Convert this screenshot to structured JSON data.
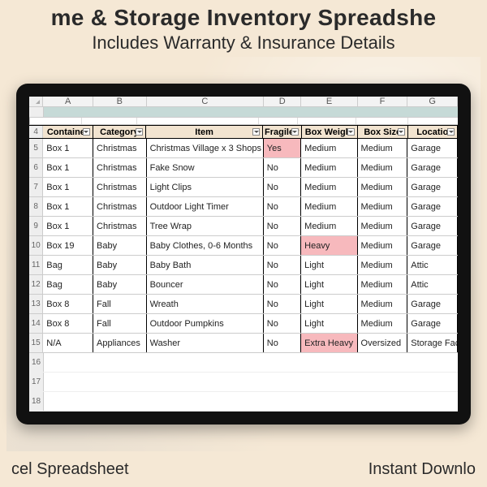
{
  "hero": {
    "title": "me & Storage Inventory Spreadshe",
    "subtitle": "Includes Warranty & Insurance Details"
  },
  "footer": {
    "left": "cel Spreadsheet",
    "right": "Instant Downlo"
  },
  "spreadsheet": {
    "colLetters": [
      "A",
      "B",
      "C",
      "D",
      "E",
      "F",
      "G"
    ],
    "bannerRowNum": "",
    "spacerRowNum": "",
    "headerRowNum": "4",
    "headers": [
      "Container",
      "Category",
      "Item",
      "Fragile?",
      "Box Weight",
      "Box Size",
      "Locatio"
    ],
    "rows": [
      {
        "num": "5",
        "cells": [
          "Box 1",
          "Christmas",
          "Christmas Village x 3 Shops",
          "Yes",
          "Medium",
          "Medium",
          "Garage"
        ],
        "hl": [
          3
        ]
      },
      {
        "num": "6",
        "cells": [
          "Box 1",
          "Christmas",
          "Fake Snow",
          "No",
          "Medium",
          "Medium",
          "Garage"
        ],
        "hl": []
      },
      {
        "num": "7",
        "cells": [
          "Box 1",
          "Christmas",
          "Light Clips",
          "No",
          "Medium",
          "Medium",
          "Garage"
        ],
        "hl": []
      },
      {
        "num": "8",
        "cells": [
          "Box 1",
          "Christmas",
          "Outdoor Light Timer",
          "No",
          "Medium",
          "Medium",
          "Garage"
        ],
        "hl": []
      },
      {
        "num": "9",
        "cells": [
          "Box 1",
          "Christmas",
          "Tree Wrap",
          "No",
          "Medium",
          "Medium",
          "Garage"
        ],
        "hl": []
      },
      {
        "num": "10",
        "cells": [
          "Box 19",
          "Baby",
          "Baby Clothes, 0-6 Months",
          "No",
          "Heavy",
          "Medium",
          "Garage"
        ],
        "hl": [
          4
        ]
      },
      {
        "num": "11",
        "cells": [
          "Bag",
          "Baby",
          "Baby Bath",
          "No",
          "Light",
          "Medium",
          "Attic"
        ],
        "hl": []
      },
      {
        "num": "12",
        "cells": [
          "Bag",
          "Baby",
          "Bouncer",
          "No",
          "Light",
          "Medium",
          "Attic"
        ],
        "hl": []
      },
      {
        "num": "13",
        "cells": [
          "Box 8",
          "Fall",
          "Wreath",
          "No",
          "Light",
          "Medium",
          "Garage"
        ],
        "hl": []
      },
      {
        "num": "14",
        "cells": [
          "Box 8",
          "Fall",
          "Outdoor Pumpkins",
          "No",
          "Light",
          "Medium",
          "Garage"
        ],
        "hl": []
      },
      {
        "num": "15",
        "cells": [
          "N/A",
          "Appliances",
          "Washer",
          "No",
          "Extra Heavy",
          "Oversized",
          "Storage Fac"
        ],
        "hl": [
          4
        ]
      }
    ],
    "emptyRows": [
      "16",
      "17",
      "18"
    ]
  }
}
